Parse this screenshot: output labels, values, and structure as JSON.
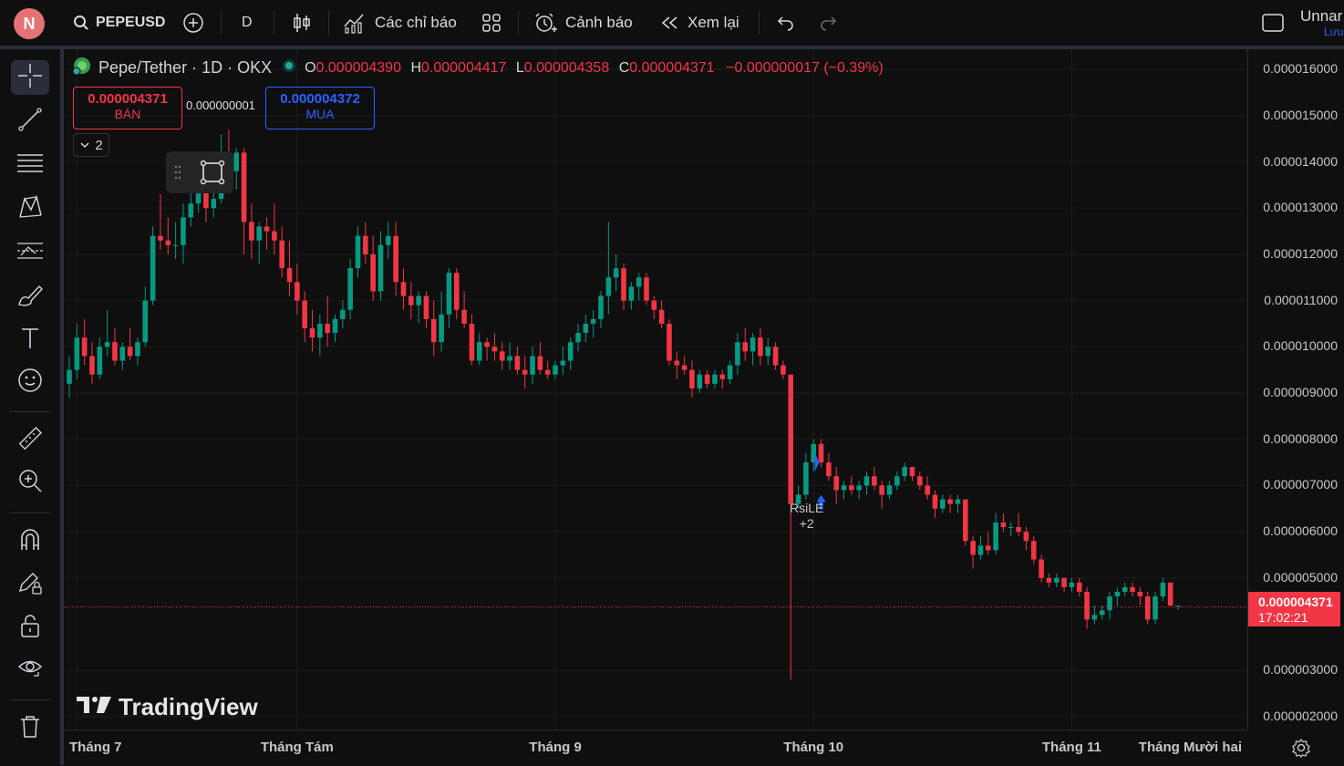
{
  "header": {
    "avatar_letter": "N",
    "symbol": "PEPEUSD",
    "interval": "D",
    "indicators_label": "Các chỉ báo",
    "alerts_label": "Cảnh báo",
    "replay_label": "Xem lại",
    "layout_name": "Unnar",
    "layout_save": "Lưu"
  },
  "legend": {
    "title": "Pepe/Tether · 1D · OKX",
    "o_key": "O",
    "o_val": "0.000004390",
    "h_key": "H",
    "h_val": "0.000004417",
    "l_key": "L",
    "l_val": "0.000004358",
    "c_key": "C",
    "c_val": "0.000004371",
    "change": "−0.000000017 (−0.39%)"
  },
  "trade": {
    "sell_price": "0.000004371",
    "sell_label": "BÁN",
    "spread": "0.000000001",
    "buy_price": "0.000004372",
    "buy_label": "MUA"
  },
  "collapse_count": "2",
  "price_ticks": [
    "0.000016000",
    "0.000015000",
    "0.000014000",
    "0.000013000",
    "0.000012000",
    "0.000011000",
    "0.000010000",
    "0.000009000",
    "0.000008000",
    "0.000007000",
    "0.000006000",
    "0.000005000",
    "0.000003000",
    "0.000002000"
  ],
  "time_labels": [
    "Tháng 7",
    "Tháng Tám",
    "Tháng 9",
    "Tháng 10",
    "Tháng 11",
    "Tháng Mười hai"
  ],
  "current_price": {
    "price": "0.000004371",
    "countdown": "17:02:21"
  },
  "signal": {
    "name": "RsiLE",
    "extra": "+2"
  },
  "watermark": "TradingView",
  "colors": {
    "up": "#089981",
    "down": "#f23645",
    "buy": "#2962ff",
    "bg": "#0f0f0f"
  },
  "chart_data": {
    "type": "candlestick",
    "symbol": "PEPEUSD",
    "ylim": [
      1.8e-06,
      1.62e-05
    ],
    "candles": [
      [
        9.2e-06,
        9.8e-06,
        8.9e-06,
        9.5e-06
      ],
      [
        9.5e-06,
        1.05e-05,
        9.3e-06,
        1.02e-05
      ],
      [
        1.02e-05,
        1.06e-05,
        9.6e-06,
        9.8e-06
      ],
      [
        9.8e-06,
        1.01e-05,
        9.2e-06,
        9.4e-06
      ],
      [
        9.4e-06,
        1.02e-05,
        9.3e-06,
        1e-05
      ],
      [
        1e-05,
        1.08e-05,
        9.8e-06,
        1.01e-05
      ],
      [
        1.01e-05,
        1.04e-05,
        9.6e-06,
        9.7e-06
      ],
      [
        9.7e-06,
        1.01e-05,
        9.5e-06,
        1e-05
      ],
      [
        1e-05,
        1.04e-05,
        9.7e-06,
        9.8e-06
      ],
      [
        9.8e-06,
        1.02e-05,
        9.6e-06,
        1.01e-05
      ],
      [
        1.01e-05,
        1.13e-05,
        1e-05,
        1.1e-05
      ],
      [
        1.1e-05,
        1.26e-05,
        1.09e-05,
        1.24e-05
      ],
      [
        1.24e-05,
        1.33e-05,
        1.21e-05,
        1.23e-05
      ],
      [
        1.23e-05,
        1.28e-05,
        1.2e-05,
        1.22e-05
      ],
      [
        1.22e-05,
        1.27e-05,
        1.19e-05,
        1.22e-05
      ],
      [
        1.22e-05,
        1.31e-05,
        1.18e-05,
        1.28e-05
      ],
      [
        1.28e-05,
        1.37e-05,
        1.26e-05,
        1.31e-05
      ],
      [
        1.31e-05,
        1.41e-05,
        1.29e-05,
        1.37e-05
      ],
      [
        1.37e-05,
        1.4e-05,
        1.27e-05,
        1.3e-05
      ],
      [
        1.3e-05,
        1.36e-05,
        1.28e-05,
        1.32e-05
      ],
      [
        1.32e-05,
        1.46e-05,
        1.31e-05,
        1.41e-05
      ],
      [
        1.41e-05,
        1.47e-05,
        1.37e-05,
        1.38e-05
      ],
      [
        1.38e-05,
        1.43e-05,
        1.34e-05,
        1.42e-05
      ],
      [
        1.42e-05,
        1.43e-05,
        1.2e-05,
        1.27e-05
      ],
      [
        1.27e-05,
        1.31e-05,
        1.19e-05,
        1.23e-05
      ],
      [
        1.23e-05,
        1.27e-05,
        1.18e-05,
        1.26e-05
      ],
      [
        1.26e-05,
        1.28e-05,
        1.21e-05,
        1.25e-05
      ],
      [
        1.25e-05,
        1.31e-05,
        1.2e-05,
        1.23e-05
      ],
      [
        1.23e-05,
        1.26e-05,
        1.15e-05,
        1.17e-05
      ],
      [
        1.17e-05,
        1.23e-05,
        1.11e-05,
        1.14e-05
      ],
      [
        1.14e-05,
        1.18e-05,
        1.07e-05,
        1.1e-05
      ],
      [
        1.1e-05,
        1.12e-05,
        1.01e-05,
        1.04e-05
      ],
      [
        1.04e-05,
        1.08e-05,
        9.9e-06,
        1.02e-05
      ],
      [
        1.02e-05,
        1.07e-05,
        9.8e-06,
        1.05e-05
      ],
      [
        1.05e-05,
        1.11e-05,
        1e-05,
        1.03e-05
      ],
      [
        1.03e-05,
        1.07e-05,
        1.01e-05,
        1.06e-05
      ],
      [
        1.06e-05,
        1.1e-05,
        1.04e-05,
        1.08e-05
      ],
      [
        1.08e-05,
        1.19e-05,
        1.06e-05,
        1.17e-05
      ],
      [
        1.17e-05,
        1.26e-05,
        1.15e-05,
        1.24e-05
      ],
      [
        1.24e-05,
        1.27e-05,
        1.18e-05,
        1.2e-05
      ],
      [
        1.2e-05,
        1.24e-05,
        1.1e-05,
        1.12e-05
      ],
      [
        1.12e-05,
        1.25e-05,
        1.1e-05,
        1.22e-05
      ],
      [
        1.22e-05,
        1.27e-05,
        1.19e-05,
        1.24e-05
      ],
      [
        1.24e-05,
        1.27e-05,
        1.11e-05,
        1.14e-05
      ],
      [
        1.14e-05,
        1.17e-05,
        1.08e-05,
        1.11e-05
      ],
      [
        1.11e-05,
        1.14e-05,
        1.06e-05,
        1.09e-05
      ],
      [
        1.09e-05,
        1.12e-05,
        1.05e-05,
        1.11e-05
      ],
      [
        1.11e-05,
        1.12e-05,
        1.04e-05,
        1.06e-05
      ],
      [
        1.06e-05,
        1.1e-05,
        9.8e-06,
        1.01e-05
      ],
      [
        1.01e-05,
        1.12e-05,
        9.9e-06,
        1.07e-05
      ],
      [
        1.07e-05,
        1.17e-05,
        1.04e-05,
        1.16e-05
      ],
      [
        1.16e-05,
        1.17e-05,
        1.06e-05,
        1.08e-05
      ],
      [
        1.08e-05,
        1.12e-05,
        1.04e-05,
        1.05e-05
      ],
      [
        1.05e-05,
        1.07e-05,
        9.6e-06,
        9.7e-06
      ],
      [
        9.7e-06,
        1.03e-05,
        9.6e-06,
        1.01e-05
      ],
      [
        1.01e-05,
        1.02e-05,
        9.7e-06,
        1e-05
      ],
      [
        1e-05,
        1.03e-05,
        9.7e-06,
        9.9e-06
      ],
      [
        9.9e-06,
        1.01e-05,
        9.5e-06,
        9.7e-06
      ],
      [
        9.7e-06,
        1.01e-05,
        9.5e-06,
        9.8e-06
      ],
      [
        9.8e-06,
        1e-05,
        9.4e-06,
        9.5e-06
      ],
      [
        9.5e-06,
        9.8e-06,
        9.1e-06,
        9.4e-06
      ],
      [
        9.4e-06,
        1e-05,
        9.2e-06,
        9.8e-06
      ],
      [
        9.8e-06,
        1.01e-05,
        9.4e-06,
        9.5e-06
      ],
      [
        9.5e-06,
        9.7e-06,
        9.3e-06,
        9.4e-06
      ],
      [
        9.4e-06,
        9.7e-06,
        9.3e-06,
        9.6e-06
      ],
      [
        9.6e-06,
        1e-05,
        9.4e-06,
        9.7e-06
      ],
      [
        9.7e-06,
        1.02e-05,
        9.5e-06,
        1.01e-05
      ],
      [
        1.01e-05,
        1.05e-05,
        9.9e-06,
        1.03e-05
      ],
      [
        1.03e-05,
        1.07e-05,
        1.01e-05,
        1.05e-05
      ],
      [
        1.05e-05,
        1.08e-05,
        1.02e-05,
        1.06e-05
      ],
      [
        1.06e-05,
        1.12e-05,
        1.04e-05,
        1.11e-05
      ],
      [
        1.11e-05,
        1.27e-05,
        1.07e-05,
        1.15e-05
      ],
      [
        1.15e-05,
        1.2e-05,
        1.12e-05,
        1.17e-05
      ],
      [
        1.17e-05,
        1.18e-05,
        1.08e-05,
        1.1e-05
      ],
      [
        1.1e-05,
        1.14e-05,
        1.08e-05,
        1.13e-05
      ],
      [
        1.13e-05,
        1.16e-05,
        1.1e-05,
        1.15e-05
      ],
      [
        1.15e-05,
        1.16e-05,
        1.09e-05,
        1.1e-05
      ],
      [
        1.1e-05,
        1.11e-05,
        1.06e-05,
        1.08e-05
      ],
      [
        1.08e-05,
        1.1e-05,
        1.04e-05,
        1.05e-05
      ],
      [
        1.05e-05,
        1.06e-05,
        9.6e-06,
        9.7e-06
      ],
      [
        9.7e-06,
        9.9e-06,
        9.3e-06,
        9.6e-06
      ],
      [
        9.6e-06,
        9.8e-06,
        9.4e-06,
        9.5e-06
      ],
      [
        9.5e-06,
        9.7e-06,
        8.9e-06,
        9.1e-06
      ],
      [
        9.1e-06,
        9.5e-06,
        9e-06,
        9.4e-06
      ],
      [
        9.4e-06,
        9.5e-06,
        9.1e-06,
        9.2e-06
      ],
      [
        9.2e-06,
        9.5e-06,
        9.1e-06,
        9.4e-06
      ],
      [
        9.4e-06,
        9.5e-06,
        9.1e-06,
        9.3e-06
      ],
      [
        9.3e-06,
        9.7e-06,
        9.2e-06,
        9.6e-06
      ],
      [
        9.6e-06,
        1.03e-05,
        9.4e-06,
        1.01e-05
      ],
      [
        1.01e-05,
        1.04e-05,
        9.7e-06,
        9.9e-06
      ],
      [
        9.9e-06,
        1.03e-05,
        9.6e-06,
        1.02e-05
      ],
      [
        1.02e-05,
        1.04e-05,
        9.6e-06,
        9.8e-06
      ],
      [
        9.8e-06,
        1.02e-05,
        9.6e-06,
        1e-05
      ],
      [
        1e-05,
        1.01e-05,
        9.5e-06,
        9.6e-06
      ],
      [
        9.6e-06,
        9.7e-06,
        9.3e-06,
        9.4e-06
      ],
      [
        9.4e-06,
        9.3e-06,
        2.8e-06,
        6.6e-06
      ],
      [
        6.6e-06,
        7e-06,
        6.5e-06,
        6.8e-06
      ],
      [
        6.8e-06,
        7.7e-06,
        6.7e-06,
        7.5e-06
      ],
      [
        7.5e-06,
        8e-06,
        7.3e-06,
        7.9e-06
      ],
      [
        7.9e-06,
        8e-06,
        7.4e-06,
        7.5e-06
      ],
      [
        7.5e-06,
        7.7e-06,
        7.1e-06,
        7.2e-06
      ],
      [
        7.2e-06,
        7.4e-06,
        6.6e-06,
        6.9e-06
      ],
      [
        6.9e-06,
        7.1e-06,
        6.7e-06,
        7e-06
      ],
      [
        7e-06,
        7.2e-06,
        6.8e-06,
        6.9e-06
      ],
      [
        6.9e-06,
        7.1e-06,
        6.7e-06,
        7e-06
      ],
      [
        7e-06,
        7.3e-06,
        6.8e-06,
        7.2e-06
      ],
      [
        7.2e-06,
        7.4e-06,
        6.9e-06,
        7e-06
      ],
      [
        7e-06,
        7.1e-06,
        6.5e-06,
        6.8e-06
      ],
      [
        6.8e-06,
        7.1e-06,
        6.7e-06,
        7e-06
      ],
      [
        7e-06,
        7.3e-06,
        6.9e-06,
        7.2e-06
      ],
      [
        7.2e-06,
        7.5e-06,
        7.1e-06,
        7.4e-06
      ],
      [
        7.4e-06,
        7.4e-06,
        7.1e-06,
        7.2e-06
      ],
      [
        7.2e-06,
        7.3e-06,
        6.9e-06,
        7e-06
      ],
      [
        7e-06,
        7.2e-06,
        6.7e-06,
        6.8e-06
      ],
      [
        6.8e-06,
        6.9e-06,
        6.3e-06,
        6.5e-06
      ],
      [
        6.5e-06,
        6.8e-06,
        6.4e-06,
        6.7e-06
      ],
      [
        6.7e-06,
        6.8e-06,
        6.4e-06,
        6.6e-06
      ],
      [
        6.6e-06,
        6.8e-06,
        6.4e-06,
        6.7e-06
      ],
      [
        6.7e-06,
        6.7e-06,
        5.7e-06,
        5.8e-06
      ],
      [
        5.8e-06,
        5.9e-06,
        5.2e-06,
        5.5e-06
      ],
      [
        5.5e-06,
        5.9e-06,
        5.4e-06,
        5.7e-06
      ],
      [
        5.7e-06,
        6e-06,
        5.5e-06,
        5.6e-06
      ],
      [
        5.6e-06,
        6.4e-06,
        5.5e-06,
        6.2e-06
      ],
      [
        6.2e-06,
        6.4e-06,
        6e-06,
        6.1e-06
      ],
      [
        6.1e-06,
        6.2e-06,
        5.9e-06,
        6.1e-06
      ],
      [
        6.1e-06,
        6.4e-06,
        5.9e-06,
        6e-06
      ],
      [
        6e-06,
        6.1e-06,
        5.6e-06,
        5.8e-06
      ],
      [
        5.8e-06,
        5.9e-06,
        5.3e-06,
        5.4e-06
      ],
      [
        5.4e-06,
        5.5e-06,
        4.9e-06,
        5e-06
      ],
      [
        5e-06,
        5.1e-06,
        4.8e-06,
        4.9e-06
      ],
      [
        4.9e-06,
        5.1e-06,
        4.8e-06,
        5e-06
      ],
      [
        5e-06,
        5e-06,
        4.7e-06,
        4.8e-06
      ],
      [
        4.8e-06,
        5e-06,
        4.7e-06,
        4.9e-06
      ],
      [
        4.9e-06,
        5e-06,
        4.6e-06,
        4.7e-06
      ],
      [
        4.7e-06,
        4.8e-06,
        3.9e-06,
        4.1e-06
      ],
      [
        4.1e-06,
        4.4e-06,
        4e-06,
        4.2e-06
      ],
      [
        4.2e-06,
        4.4e-06,
        4.1e-06,
        4.3e-06
      ],
      [
        4.3e-06,
        4.7e-06,
        4.1e-06,
        4.6e-06
      ],
      [
        4.6e-06,
        4.8e-06,
        4.4e-06,
        4.7e-06
      ],
      [
        4.7e-06,
        4.9e-06,
        4.6e-06,
        4.8e-06
      ],
      [
        4.8e-06,
        4.9e-06,
        4.6e-06,
        4.7e-06
      ],
      [
        4.7e-06,
        4.8e-06,
        4.4e-06,
        4.6e-06
      ],
      [
        4.6e-06,
        4.7e-06,
        4e-06,
        4.1e-06
      ],
      [
        4.1e-06,
        4.7e-06,
        4e-06,
        4.6e-06
      ],
      [
        4.6e-06,
        5e-06,
        4.5e-06,
        4.9e-06
      ],
      [
        4.9e-06,
        4.9e-06,
        4.4e-06,
        4.4e-06
      ],
      [
        4.4e-06,
        4.4e-06,
        4.3e-06,
        4.4e-06
      ]
    ]
  }
}
